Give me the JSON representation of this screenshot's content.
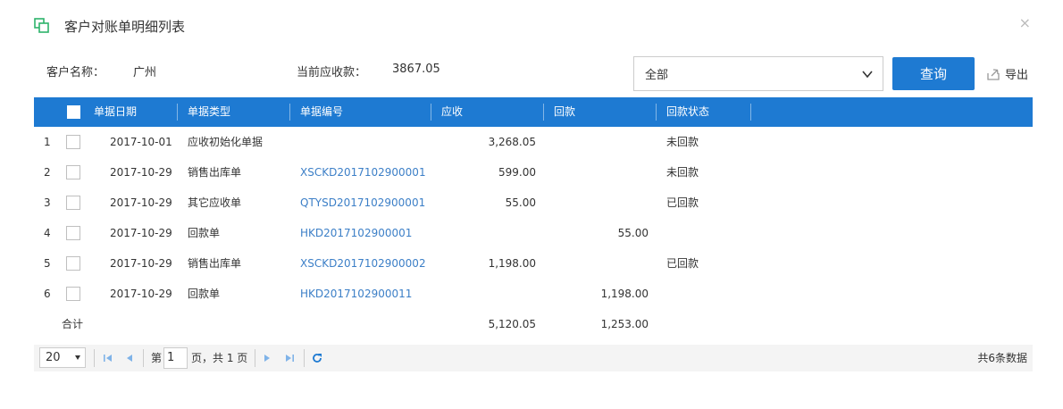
{
  "dialog": {
    "title": "客户对账单明细列表",
    "close_label": "×"
  },
  "info": {
    "customer_label": "客户名称：",
    "customer_value": "广州",
    "receivable_label": "当前应收款：",
    "receivable_value": "3867.05"
  },
  "filter": {
    "selected": "全部",
    "query_label": "查询",
    "export_label": "导出"
  },
  "table": {
    "columns": [
      "单据日期",
      "单据类型",
      "单据编号",
      "应收",
      "回款",
      "回款状态"
    ],
    "rows": [
      {
        "idx": "1",
        "date": "2017-10-01",
        "type": "应收初始化单据",
        "code": "",
        "receivable": "3,268.05",
        "payback": "",
        "status": "未回款"
      },
      {
        "idx": "2",
        "date": "2017-10-29",
        "type": "销售出库单",
        "code": "XSCKD2017102900001",
        "receivable": "599.00",
        "payback": "",
        "status": "未回款"
      },
      {
        "idx": "3",
        "date": "2017-10-29",
        "type": "其它应收单",
        "code": "QTYSD2017102900001",
        "receivable": "55.00",
        "payback": "",
        "status": "已回款"
      },
      {
        "idx": "4",
        "date": "2017-10-29",
        "type": "回款单",
        "code": "HKD2017102900001",
        "receivable": "",
        "payback": "55.00",
        "status": ""
      },
      {
        "idx": "5",
        "date": "2017-10-29",
        "type": "销售出库单",
        "code": "XSCKD2017102900002",
        "receivable": "1,198.00",
        "payback": "",
        "status": "已回款"
      },
      {
        "idx": "6",
        "date": "2017-10-29",
        "type": "回款单",
        "code": "HKD2017102900011",
        "receivable": "",
        "payback": "1,198.00",
        "status": ""
      }
    ],
    "total": {
      "label": "合计",
      "receivable": "5,120.05",
      "payback": "1,253.00"
    }
  },
  "pager": {
    "page_size": "20",
    "page_prefix": "第",
    "page_value": "1",
    "page_suffix": "页，共 1 页",
    "total_text": "共6条数据"
  },
  "colors": {
    "primary": "#1e7ad2",
    "link": "#3c7fc7",
    "icon_green": "#2db36b"
  }
}
